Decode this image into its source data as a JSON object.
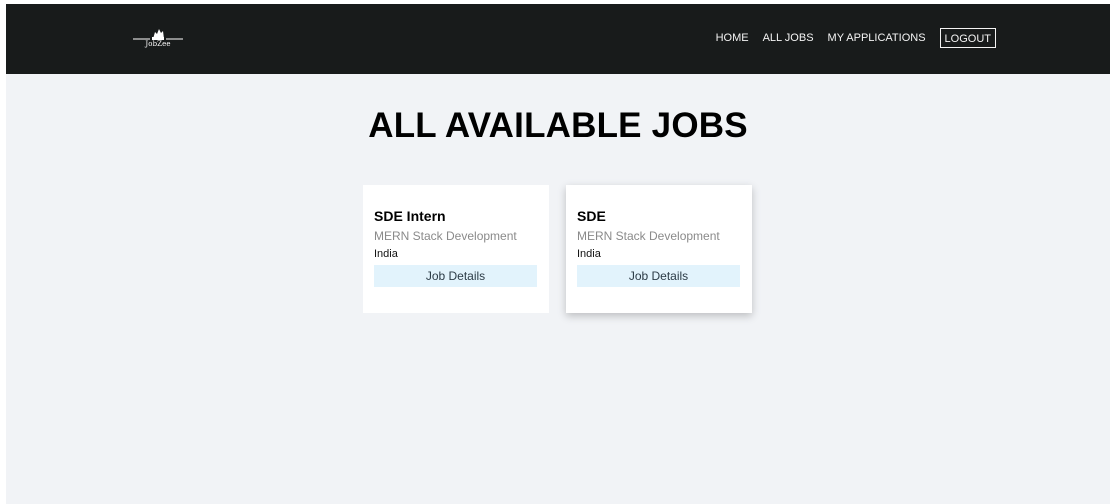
{
  "brand": {
    "name": "JobZee"
  },
  "nav": {
    "items": [
      {
        "label": "HOME"
      },
      {
        "label": "ALL JOBS"
      },
      {
        "label": "MY APPLICATIONS"
      }
    ],
    "logout_label": "LOGOUT"
  },
  "page": {
    "title": "ALL AVAILABLE JOBS"
  },
  "jobs": [
    {
      "title": "SDE Intern",
      "category": "MERN Stack Development",
      "location": "India",
      "details_label": "Job Details"
    },
    {
      "title": "SDE",
      "category": "MERN Stack Development",
      "location": "India",
      "details_label": "Job Details"
    }
  ],
  "colors": {
    "navbar": "#181b1b",
    "page_background": "#f1f3f6",
    "button_background": "#e2f3fc"
  },
  "icons": {
    "logo": "briefcase-logo-icon"
  }
}
